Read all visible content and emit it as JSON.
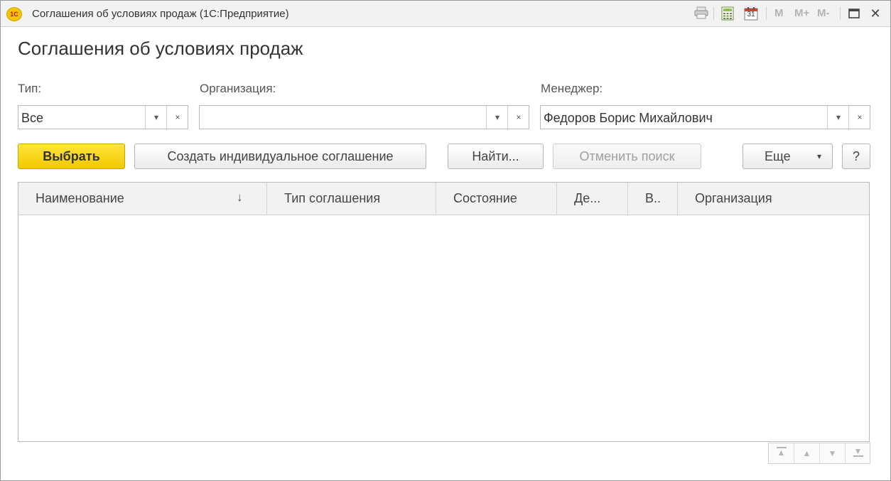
{
  "window": {
    "app_logo": "1С",
    "title": "Соглашения об условиях продаж  (1С:Предприятие)",
    "toolbar": {
      "print_icon": "printer-icon",
      "calculator_icon": "calculator-icon",
      "calendar_day": "31",
      "m_label": "M",
      "m_plus_label": "M+",
      "m_minus_label": "M-"
    },
    "maximize_glyph": "☐",
    "close_glyph": "✕"
  },
  "form": {
    "title": "Соглашения об условиях продаж",
    "filters": {
      "type": {
        "label": "Тип:",
        "value": "Все"
      },
      "organization": {
        "label": "Организация:",
        "value": ""
      },
      "manager": {
        "label": "Менеджер:",
        "value": "Федоров Борис Михайлович"
      }
    },
    "dropdown_glyph": "▾",
    "clear_glyph": "×",
    "buttons": {
      "select": "Выбрать",
      "create_individual": "Создать индивидуальное соглашение",
      "find": "Найти...",
      "cancel_search": "Отменить поиск",
      "more": "Еще",
      "help": "?"
    }
  },
  "table": {
    "columns": [
      "Наименование",
      "Тип соглашения",
      "Состояние",
      "Де...",
      "В..",
      "Организация"
    ],
    "sort_glyph": "↓",
    "rows": []
  },
  "navigation": {
    "first_glyph": "▲",
    "prev_glyph": "▲",
    "next_glyph": "▼",
    "last_glyph": "▼"
  }
}
